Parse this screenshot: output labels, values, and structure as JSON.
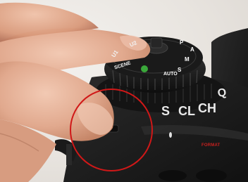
{
  "scene": "Close-up of a finger pressing the release-mode dial lock button on a Nikon DSLR camera",
  "camera": {
    "release_modes": {
      "s": "S",
      "cl": "CL",
      "ch": "CH",
      "q": "Q"
    },
    "mode_dial": {
      "scene": "SCENE",
      "u1": "U1",
      "u2": "U2",
      "p": "P",
      "s": "S",
      "a": "A",
      "m": "M",
      "auto": "AUTO"
    },
    "format_button_label": "FORMAT"
  },
  "colors": {
    "highlight_circle": "#d01818",
    "background": "#ece8e3",
    "camera_body": "#1d1d1d",
    "skin": "#e7b39a",
    "dial_green": "#3aa83a"
  }
}
